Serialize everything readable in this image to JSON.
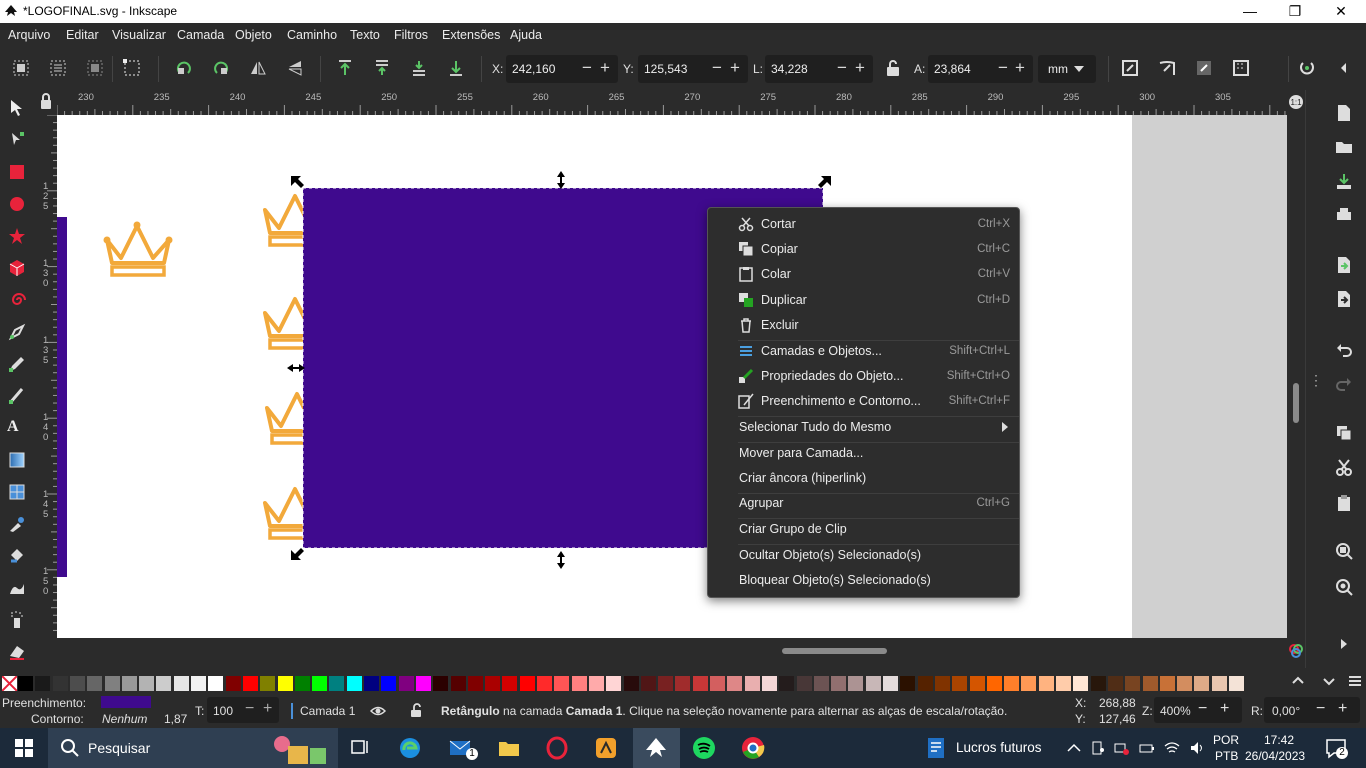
{
  "window": {
    "title": "*LOGOFINAL.svg - Inkscape",
    "minimize": "—",
    "maximize": "❐",
    "close": "✕"
  },
  "menu": [
    "Arquivo",
    "Editar",
    "Visualizar",
    "Camada",
    "Objeto",
    "Caminho",
    "Texto",
    "Filtros",
    "Extensões",
    "Ajuda"
  ],
  "toolbar": {
    "x_label": "X:",
    "x_value": "242,160",
    "y_label": "Y:",
    "y_value": "125,543",
    "w_label": "L:",
    "w_value": "34,228",
    "h_label": "A:",
    "h_value": "23,864",
    "unit": "mm"
  },
  "ruler": [
    "230",
    "235",
    "240",
    "245",
    "250",
    "255",
    "260",
    "265",
    "270",
    "275",
    "280",
    "285",
    "290",
    "295",
    "300",
    "305"
  ],
  "ruler_v": [
    "1",
    "2",
    "5",
    "1",
    "3",
    "0",
    "1",
    "3",
    "5",
    "1",
    "4",
    "0",
    "1",
    "4",
    "5",
    "1",
    "5",
    "0"
  ],
  "context_menu": {
    "items": [
      {
        "label": "Cortar",
        "shortcut": "Ctrl+X",
        "icon": "scissors-icon"
      },
      {
        "label": "Copiar",
        "shortcut": "Ctrl+C",
        "icon": "copy-icon"
      },
      {
        "label": "Colar",
        "shortcut": "Ctrl+V",
        "icon": "paste-icon"
      },
      {
        "label": "Duplicar",
        "shortcut": "Ctrl+D",
        "icon": "duplicate-icon"
      },
      {
        "label": "Excluir",
        "shortcut": "",
        "icon": "trash-icon"
      },
      {
        "label": "Camadas e Objetos...",
        "shortcut": "Shift+Ctrl+L",
        "icon": "layers-icon"
      },
      {
        "label": "Propriedades do Objeto...",
        "shortcut": "Shift+Ctrl+O",
        "icon": "properties-icon"
      },
      {
        "label": "Preenchimento e Contorno...",
        "shortcut": "Shift+Ctrl+F",
        "icon": "fill-stroke-icon"
      },
      {
        "label": "Selecionar Tudo do Mesmo",
        "shortcut": "",
        "icon": ""
      },
      {
        "label": "Mover para Camada...",
        "shortcut": "",
        "icon": ""
      },
      {
        "label": "Criar âncora (hiperlink)",
        "shortcut": "",
        "icon": ""
      },
      {
        "label": "Agrupar",
        "shortcut": "Ctrl+G",
        "icon": ""
      },
      {
        "label": "Criar Grupo de Clip",
        "shortcut": "",
        "icon": ""
      },
      {
        "label": "Ocultar Objeto(s) Selecionado(s)",
        "shortcut": "",
        "icon": ""
      },
      {
        "label": "Bloquear Objeto(s) Selecionado(s)",
        "shortcut": "",
        "icon": ""
      }
    ]
  },
  "status": {
    "fill_label": "Preenchimento:",
    "stroke_label": "Contorno:",
    "stroke_value": "Nenhum",
    "stroke_width": "1,87",
    "opacity_label": "T:",
    "opacity_value": "100",
    "layer": "Camada 1",
    "msg_bold": "Retângulo",
    "msg_rest": " na camada ",
    "msg_layer": "Camada 1",
    "msg_tail": ". Clique na seleção novamente para alternar as alças de escala/rotação.",
    "cursor_x_label": "X:",
    "cursor_x": "268,88",
    "cursor_y_label": "Y:",
    "cursor_y": "127,46",
    "zoom_label": "Z:",
    "zoom": "400%",
    "rot_label": "R:",
    "rotation": "0,00°"
  },
  "colors": {
    "fill": "#3f0a8e",
    "crown": "#f2a93b",
    "accent_purple": "#3f0a8e"
  },
  "taskbar": {
    "search_placeholder": "Pesquisar",
    "news": "Lucros futuros",
    "lang1": "POR",
    "lang2": "PTB",
    "time": "17:42",
    "date": "26/04/2023",
    "mail_badge": "1",
    "notif_badge": "2"
  }
}
